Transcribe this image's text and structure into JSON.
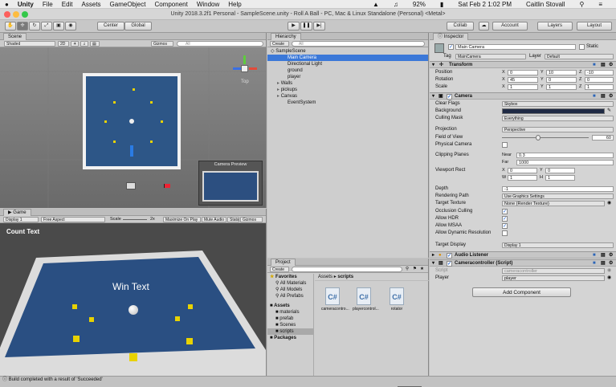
{
  "menubar": {
    "apple": "",
    "items": [
      "Unity",
      "File",
      "Edit",
      "Assets",
      "GameObject",
      "Component",
      "Window",
      "Help"
    ],
    "status": {
      "battery": "92%",
      "datetime": "Sat Feb 2  1:02 PM",
      "user": "Caitlin Stovall"
    }
  },
  "window_title": "Unity 2018.3.2f1 Personal - SampleScene.unity - Roll A Ball - PC, Mac & Linux Standalone (Personal) <Metal>",
  "toolbar": {
    "pivot": "Center",
    "space": "Global",
    "collab": "Collab",
    "account": "Account",
    "layers": "Layers",
    "layout": "Layout"
  },
  "scene": {
    "tab": "Scene",
    "shading": "Shaded",
    "mode2d": "2D",
    "gizmos": "Gizmos",
    "search_placeholder": "All",
    "gizmo_label": "Top",
    "camera_preview": "Camera Preview"
  },
  "game": {
    "tab": "Game",
    "display": "Display 1",
    "aspect": "Free Aspect",
    "scale_label": "Scale",
    "scale_value": "2x",
    "maximize": "Maximize On Play",
    "mute": "Mute Audio",
    "stats": "Stats",
    "gizmos": "Gizmos",
    "count_text": "Count Text",
    "win_text": "Win Text"
  },
  "hierarchy": {
    "tab": "Hierarchy",
    "create": "Create",
    "search_placeholder": "All",
    "scene_name": "SampleScene",
    "items": [
      "Main Camera",
      "Directional Light",
      "ground",
      "player",
      "Walls",
      "pickups",
      "Canvas",
      "EventSystem"
    ],
    "selected": "Main Camera"
  },
  "project": {
    "tab": "Project",
    "create": "Create",
    "favorites_label": "Favorites",
    "favorites": [
      "All Materials",
      "All Models",
      "All Prefabs"
    ],
    "assets_label": "Assets",
    "asset_folders": [
      "materials",
      "prefab",
      "Scenes",
      "scripts"
    ],
    "packages_label": "Packages",
    "breadcrumb": [
      "Assets",
      "scripts"
    ],
    "files": [
      "cameracontro...",
      "playercontrol...",
      "rotator"
    ],
    "file_icon_text": "C#"
  },
  "inspector": {
    "tab": "Inspector",
    "object_name": "Main Camera",
    "static": "Static",
    "tag_label": "Tag",
    "tag": "MainCamera",
    "layer_label": "Layer",
    "layer": "Default",
    "transform": {
      "title": "Transform",
      "position_label": "Position",
      "position": [
        "0",
        "10",
        "-10"
      ],
      "rotation_label": "Rotation",
      "rotation": [
        "45",
        "0",
        "0"
      ],
      "scale_label": "Scale",
      "scale": [
        "1",
        "1",
        "1"
      ]
    },
    "camera": {
      "title": "Camera",
      "clear_flags_label": "Clear Flags",
      "clear_flags": "Skybox",
      "background_label": "Background",
      "culling_mask_label": "Culling Mask",
      "culling_mask": "Everything",
      "projection_label": "Projection",
      "projection": "Perspective",
      "fov_label": "Field of View",
      "fov": "60",
      "fov_fraction": 0.42,
      "physical_label": "Physical Camera",
      "clipping_label": "Clipping Planes",
      "near_label": "Near",
      "near": "0.3",
      "far_label": "Far",
      "far": "1000",
      "viewport_label": "Viewport Rect",
      "vx": "0",
      "vy": "0",
      "vw": "1",
      "vh": "1",
      "depth_label": "Depth",
      "depth": "-1",
      "rendering_label": "Rendering Path",
      "rendering": "Use Graphics Settings",
      "target_texture_label": "Target Texture",
      "target_texture": "None (Render Texture)",
      "occlusion_label": "Occlusion Culling",
      "hdr_label": "Allow HDR",
      "msaa_label": "Allow MSAA",
      "dynres_label": "Allow Dynamic Resolution",
      "target_display_label": "Target Display",
      "target_display": "Display 1"
    },
    "audio_listener": "Audio Listener",
    "camcontroller": {
      "title": "Cameracontroller (Script)",
      "script_label": "Script",
      "script": "cameracontroller",
      "player_label": "Player",
      "player": "player"
    },
    "add_component": "Add Component"
  },
  "statusbar": "Build completed with a result of 'Succeeded'",
  "colors": {
    "selection": "#3b78d8",
    "ground": "#2a4f82",
    "pickup": "#e8d200"
  }
}
